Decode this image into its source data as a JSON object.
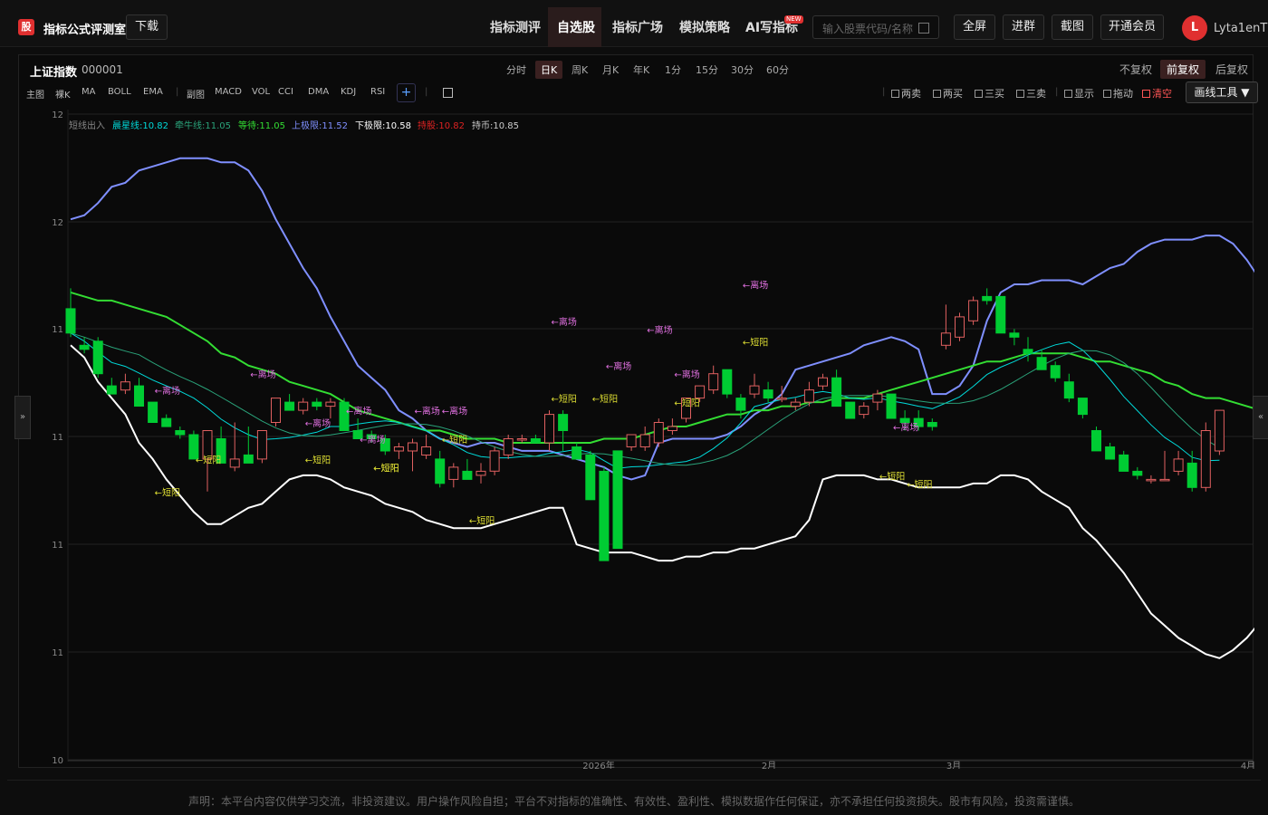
{
  "app": {
    "logo_text": "股",
    "title": "指标公式评测室",
    "download": "下载"
  },
  "nav": {
    "items": [
      "指标测评",
      "自选股",
      "指标广场",
      "模拟策略",
      "AI写指标"
    ],
    "active": 1,
    "new_badge": "NEW"
  },
  "search": {
    "placeholder": "输入股票代码/名称"
  },
  "actions": {
    "fullscreen": "全屏",
    "join": "进群",
    "screenshot": "截图",
    "member": "开通会员"
  },
  "user": {
    "initial": "L",
    "name": "Lyta1enT"
  },
  "stock": {
    "name": "上证指数",
    "code": "000001"
  },
  "periods": {
    "items": [
      "分时",
      "日K",
      "周K",
      "月K",
      "年K",
      "1分",
      "15分",
      "30分",
      "60分"
    ],
    "active": 1
  },
  "adjust": {
    "items": [
      "不复权",
      "前复权",
      "后复权"
    ],
    "active": 1
  },
  "indicators": {
    "main_label": "主图",
    "main": [
      "裸K",
      "MA",
      "BOLL",
      "EMA"
    ],
    "sub_label": "副图",
    "sub": [
      "MACD",
      "VOL",
      "CCI",
      "DMA",
      "KDJ",
      "RSI"
    ],
    "add": "+"
  },
  "signals": {
    "items": [
      "两卖",
      "两买",
      "三买",
      "三卖"
    ],
    "tools": [
      "显示",
      "拖动"
    ],
    "clear": "清空",
    "draw_tool": "画线工具 ▼"
  },
  "legend": {
    "name": "短线出入",
    "entries": [
      {
        "label": "晨星线:10.82",
        "color": "#00d9d9"
      },
      {
        "label": "牵牛线:11.05",
        "color": "#2aa37a"
      },
      {
        "label": "等待:11.05",
        "color": "#33dd33"
      },
      {
        "label": "上极限:11.52",
        "color": "#7f8fff"
      },
      {
        "label": "下极限:10.58",
        "color": "#ffffff"
      },
      {
        "label": "持股:10.82",
        "color": "#dd2222"
      },
      {
        "label": "持币:10.85",
        "color": "#cccccc"
      }
    ]
  },
  "chart_data": {
    "type": "candlestick",
    "y_ticks": [
      "12",
      "12",
      "11",
      "11",
      "11",
      "11",
      "10"
    ],
    "x_ticks": [
      "2026年",
      "2月",
      "3月",
      "4月"
    ],
    "up_color": "#e06060",
    "down_color": "#00cc33",
    "candles": [
      {
        "o": 11.93,
        "h": 11.98,
        "l": 11.86,
        "c": 11.87
      },
      {
        "o": 11.84,
        "h": 11.86,
        "l": 11.82,
        "c": 11.83
      },
      {
        "o": 11.85,
        "h": 11.86,
        "l": 11.76,
        "c": 11.77
      },
      {
        "o": 11.74,
        "h": 11.76,
        "l": 11.72,
        "c": 11.72
      },
      {
        "o": 11.73,
        "h": 11.77,
        "l": 11.72,
        "c": 11.75
      },
      {
        "o": 11.74,
        "h": 11.76,
        "l": 11.69,
        "c": 11.69
      },
      {
        "o": 11.7,
        "h": 11.7,
        "l": 11.65,
        "c": 11.65
      },
      {
        "o": 11.66,
        "h": 11.67,
        "l": 11.64,
        "c": 11.64
      },
      {
        "o": 11.63,
        "h": 11.64,
        "l": 11.61,
        "c": 11.62
      },
      {
        "o": 11.62,
        "h": 11.63,
        "l": 11.56,
        "c": 11.56
      },
      {
        "o": 11.56,
        "h": 11.63,
        "l": 11.48,
        "c": 11.63
      },
      {
        "o": 11.61,
        "h": 11.64,
        "l": 11.55,
        "c": 11.55
      },
      {
        "o": 11.54,
        "h": 11.65,
        "l": 11.53,
        "c": 11.56
      },
      {
        "o": 11.57,
        "h": 11.64,
        "l": 11.56,
        "c": 11.55
      },
      {
        "o": 11.56,
        "h": 11.63,
        "l": 11.55,
        "c": 11.63
      },
      {
        "o": 11.65,
        "h": 11.71,
        "l": 11.64,
        "c": 11.71
      },
      {
        "o": 11.7,
        "h": 11.72,
        "l": 11.68,
        "c": 11.68
      },
      {
        "o": 11.68,
        "h": 11.71,
        "l": 11.67,
        "c": 11.7
      },
      {
        "o": 11.7,
        "h": 11.71,
        "l": 11.68,
        "c": 11.69
      },
      {
        "o": 11.69,
        "h": 11.71,
        "l": 11.66,
        "c": 11.7
      },
      {
        "o": 11.7,
        "h": 11.71,
        "l": 11.63,
        "c": 11.63
      },
      {
        "o": 11.63,
        "h": 11.66,
        "l": 11.61,
        "c": 11.61
      },
      {
        "o": 11.62,
        "h": 11.63,
        "l": 11.6,
        "c": 11.61
      },
      {
        "o": 11.61,
        "h": 11.62,
        "l": 11.57,
        "c": 11.58
      },
      {
        "o": 11.58,
        "h": 11.6,
        "l": 11.56,
        "c": 11.59
      },
      {
        "o": 11.58,
        "h": 11.61,
        "l": 11.53,
        "c": 11.6
      },
      {
        "o": 11.57,
        "h": 11.62,
        "l": 11.56,
        "c": 11.59
      },
      {
        "o": 11.56,
        "h": 11.58,
        "l": 11.49,
        "c": 11.5
      },
      {
        "o": 11.51,
        "h": 11.55,
        "l": 11.49,
        "c": 11.54
      },
      {
        "o": 11.53,
        "h": 11.56,
        "l": 11.52,
        "c": 11.51
      },
      {
        "o": 11.52,
        "h": 11.55,
        "l": 11.5,
        "c": 11.53
      },
      {
        "o": 11.53,
        "h": 11.59,
        "l": 11.52,
        "c": 11.58
      },
      {
        "o": 11.57,
        "h": 11.62,
        "l": 11.56,
        "c": 11.61
      },
      {
        "o": 11.61,
        "h": 11.62,
        "l": 11.6,
        "c": 11.61
      },
      {
        "o": 11.61,
        "h": 11.62,
        "l": 11.6,
        "c": 11.6
      },
      {
        "o": 11.6,
        "h": 11.68,
        "l": 11.58,
        "c": 11.67
      },
      {
        "o": 11.67,
        "h": 11.68,
        "l": 11.58,
        "c": 11.63
      },
      {
        "o": 11.59,
        "h": 11.6,
        "l": 11.56,
        "c": 11.56
      },
      {
        "o": 11.57,
        "h": 11.58,
        "l": 11.46,
        "c": 11.46
      },
      {
        "o": 11.53,
        "h": 11.54,
        "l": 11.31,
        "c": 11.31
      },
      {
        "o": 11.58,
        "h": 11.58,
        "l": 11.35,
        "c": 11.34
      },
      {
        "o": 11.59,
        "h": 11.62,
        "l": 11.58,
        "c": 11.62
      },
      {
        "o": 11.59,
        "h": 11.64,
        "l": 11.58,
        "c": 11.62
      },
      {
        "o": 11.6,
        "h": 11.66,
        "l": 11.59,
        "c": 11.65
      },
      {
        "o": 11.63,
        "h": 11.66,
        "l": 11.62,
        "c": 11.64
      },
      {
        "o": 11.66,
        "h": 11.71,
        "l": 11.65,
        "c": 11.71
      },
      {
        "o": 11.71,
        "h": 11.74,
        "l": 11.7,
        "c": 11.74
      },
      {
        "o": 11.73,
        "h": 11.79,
        "l": 11.72,
        "c": 11.77
      },
      {
        "o": 11.78,
        "h": 11.78,
        "l": 11.71,
        "c": 11.72
      },
      {
        "o": 11.71,
        "h": 11.72,
        "l": 11.66,
        "c": 11.68
      },
      {
        "o": 11.72,
        "h": 11.77,
        "l": 11.71,
        "c": 11.74
      },
      {
        "o": 11.73,
        "h": 11.75,
        "l": 11.7,
        "c": 11.71
      },
      {
        "o": 11.71,
        "h": 11.74,
        "l": 11.7,
        "c": 11.71
      },
      {
        "o": 11.69,
        "h": 11.71,
        "l": 11.68,
        "c": 11.7
      },
      {
        "o": 11.7,
        "h": 11.75,
        "l": 11.69,
        "c": 11.73
      },
      {
        "o": 11.74,
        "h": 11.77,
        "l": 11.73,
        "c": 11.76
      },
      {
        "o": 11.76,
        "h": 11.78,
        "l": 11.69,
        "c": 11.69
      },
      {
        "o": 11.7,
        "h": 11.7,
        "l": 11.66,
        "c": 11.66
      },
      {
        "o": 11.67,
        "h": 11.7,
        "l": 11.66,
        "c": 11.69
      },
      {
        "o": 11.7,
        "h": 11.73,
        "l": 11.68,
        "c": 11.72
      },
      {
        "o": 11.72,
        "h": 11.72,
        "l": 11.66,
        "c": 11.66
      },
      {
        "o": 11.66,
        "h": 11.68,
        "l": 11.63,
        "c": 11.65
      },
      {
        "o": 11.66,
        "h": 11.68,
        "l": 11.63,
        "c": 11.64
      },
      {
        "o": 11.65,
        "h": 11.66,
        "l": 11.63,
        "c": 11.64
      },
      {
        "o": 11.84,
        "h": 11.94,
        "l": 11.83,
        "c": 11.87
      },
      {
        "o": 11.86,
        "h": 11.92,
        "l": 11.85,
        "c": 11.91
      },
      {
        "o": 11.9,
        "h": 11.96,
        "l": 11.89,
        "c": 11.95
      },
      {
        "o": 11.96,
        "h": 11.98,
        "l": 11.94,
        "c": 11.95
      },
      {
        "o": 11.96,
        "h": 11.96,
        "l": 11.87,
        "c": 11.87
      },
      {
        "o": 11.87,
        "h": 11.88,
        "l": 11.84,
        "c": 11.86
      },
      {
        "o": 11.83,
        "h": 11.86,
        "l": 11.8,
        "c": 11.82
      },
      {
        "o": 11.81,
        "h": 11.83,
        "l": 11.78,
        "c": 11.78
      },
      {
        "o": 11.79,
        "h": 11.8,
        "l": 11.75,
        "c": 11.76
      },
      {
        "o": 11.75,
        "h": 11.77,
        "l": 11.7,
        "c": 11.71
      },
      {
        "o": 11.71,
        "h": 11.71,
        "l": 11.66,
        "c": 11.67
      },
      {
        "o": 11.63,
        "h": 11.64,
        "l": 11.58,
        "c": 11.58
      },
      {
        "o": 11.59,
        "h": 11.6,
        "l": 11.56,
        "c": 11.56
      },
      {
        "o": 11.57,
        "h": 11.58,
        "l": 11.53,
        "c": 11.53
      },
      {
        "o": 11.53,
        "h": 11.54,
        "l": 11.51,
        "c": 11.52
      },
      {
        "o": 11.51,
        "h": 11.52,
        "l": 11.5,
        "c": 11.51
      },
      {
        "o": 11.51,
        "h": 11.58,
        "l": 11.51,
        "c": 11.51
      },
      {
        "o": 11.53,
        "h": 11.58,
        "l": 11.52,
        "c": 11.56
      },
      {
        "o": 11.55,
        "h": 11.58,
        "l": 11.48,
        "c": 11.49
      },
      {
        "o": 11.49,
        "h": 11.65,
        "l": 11.48,
        "c": 11.63
      },
      {
        "o": 11.58,
        "h": 11.68,
        "l": 11.57,
        "c": 11.68
      }
    ],
    "signals": [
      {
        "i": 6,
        "text": "←离场",
        "type": "exit",
        "price": 11.72
      },
      {
        "i": 6,
        "text": "←短阳",
        "type": "entry",
        "price": 11.47
      },
      {
        "i": 9,
        "text": "←短阳",
        "type": "entry",
        "price": 11.55
      },
      {
        "i": 13,
        "text": "←离场",
        "type": "exit",
        "price": 11.76
      },
      {
        "i": 17,
        "text": "←离场",
        "type": "exit",
        "price": 11.64
      },
      {
        "i": 17,
        "text": "←短阳",
        "type": "entry",
        "price": 11.55
      },
      {
        "i": 21,
        "text": "←离场",
        "type": "exit",
        "price": 11.6
      },
      {
        "i": 20,
        "text": "←离场",
        "type": "exit",
        "price": 11.67
      },
      {
        "i": 22,
        "text": "←短阳",
        "type": "entry",
        "price": 11.53
      },
      {
        "i": 22,
        "text": "←短阳",
        "type": "entry",
        "price": 11.53
      },
      {
        "i": 25,
        "text": "←离场",
        "type": "exit",
        "price": 11.67
      },
      {
        "i": 27,
        "text": "←短阳",
        "type": "entry",
        "price": 11.6
      },
      {
        "i": 27,
        "text": "←离场",
        "type": "exit",
        "price": 11.67
      },
      {
        "i": 29,
        "text": "←短阳",
        "type": "entry",
        "price": 11.4
      },
      {
        "i": 35,
        "text": "←离场",
        "type": "exit",
        "price": 11.89
      },
      {
        "i": 35,
        "text": "←短阳",
        "type": "entry",
        "price": 11.7
      },
      {
        "i": 39,
        "text": "←离场",
        "type": "exit",
        "price": 11.78
      },
      {
        "i": 38,
        "text": "←短阳",
        "type": "entry",
        "price": 11.7
      },
      {
        "i": 42,
        "text": "←离场",
        "type": "exit",
        "price": 11.87
      },
      {
        "i": 44,
        "text": "←离场",
        "type": "exit",
        "price": 11.76
      },
      {
        "i": 44,
        "text": "←短阳",
        "type": "entry",
        "price": 11.69
      },
      {
        "i": 49,
        "text": "←短阳",
        "type": "entry",
        "price": 11.84
      },
      {
        "i": 49,
        "text": "←离场",
        "type": "exit",
        "price": 11.98
      },
      {
        "i": 59,
        "text": "←短阳",
        "type": "entry",
        "price": 11.51
      },
      {
        "i": 60,
        "text": "←离场",
        "type": "exit",
        "price": 11.63
      },
      {
        "i": 61,
        "text": "←短阳",
        "type": "entry",
        "price": 11.49
      }
    ],
    "lines": {
      "upper": [
        12.15,
        12.16,
        12.19,
        12.23,
        12.24,
        12.27,
        12.28,
        12.29,
        12.3,
        12.3,
        12.3,
        12.29,
        12.29,
        12.27,
        12.22,
        12.15,
        12.09,
        12.03,
        11.98,
        11.91,
        11.85,
        11.79,
        11.76,
        11.73,
        11.68,
        11.66,
        11.63,
        11.61,
        11.6,
        11.59,
        11.6,
        11.6,
        11.59,
        11.58,
        11.58,
        11.58,
        11.57,
        11.56,
        11.55,
        11.54,
        11.52,
        11.51,
        11.52,
        11.6,
        11.61,
        11.61,
        11.61,
        11.61,
        11.62,
        11.64,
        11.67,
        11.69,
        11.72,
        11.78,
        11.79,
        11.8,
        11.81,
        11.82,
        11.84,
        11.85,
        11.86,
        11.85,
        11.83,
        11.72,
        11.72,
        11.74,
        11.79,
        11.9,
        11.97,
        11.99,
        11.99,
        12.0,
        12.0,
        12.0,
        11.99,
        12.01,
        12.03,
        12.04,
        12.07,
        12.09,
        12.1,
        12.1,
        12.1,
        12.11,
        12.11,
        12.09,
        12.05,
        12.0
      ],
      "lower": [
        11.84,
        11.81,
        11.75,
        11.71,
        11.67,
        11.6,
        11.56,
        11.51,
        11.47,
        11.43,
        11.4,
        11.4,
        11.42,
        11.44,
        11.45,
        11.48,
        11.51,
        11.52,
        11.52,
        11.51,
        11.49,
        11.48,
        11.47,
        11.45,
        11.44,
        11.43,
        11.41,
        11.4,
        11.39,
        11.39,
        11.39,
        11.4,
        11.41,
        11.42,
        11.43,
        11.44,
        11.44,
        11.35,
        11.34,
        11.33,
        11.33,
        11.33,
        11.32,
        11.31,
        11.31,
        11.32,
        11.32,
        11.33,
        11.33,
        11.34,
        11.34,
        11.35,
        11.36,
        11.37,
        11.41,
        11.51,
        11.52,
        11.52,
        11.52,
        11.51,
        11.51,
        11.5,
        11.49,
        11.49,
        11.49,
        11.49,
        11.5,
        11.5,
        11.52,
        11.52,
        11.51,
        11.48,
        11.46,
        11.44,
        11.39,
        11.36,
        11.32,
        11.28,
        11.23,
        11.18,
        11.15,
        11.12,
        11.1,
        11.08,
        11.07,
        11.09,
        11.12,
        11.16
      ],
      "wait": [
        11.97,
        11.96,
        11.95,
        11.95,
        11.94,
        11.93,
        11.92,
        11.91,
        11.89,
        11.87,
        11.85,
        11.82,
        11.81,
        11.79,
        11.78,
        11.77,
        11.75,
        11.74,
        11.73,
        11.72,
        11.7,
        11.68,
        11.67,
        11.66,
        11.65,
        11.64,
        11.63,
        11.63,
        11.62,
        11.61,
        11.61,
        11.61,
        11.6,
        11.6,
        11.6,
        11.6,
        11.6,
        11.6,
        11.6,
        11.61,
        11.61,
        11.61,
        11.62,
        11.63,
        11.64,
        11.64,
        11.65,
        11.66,
        11.67,
        11.67,
        11.68,
        11.68,
        11.69,
        11.69,
        11.7,
        11.7,
        11.71,
        11.71,
        11.71,
        11.72,
        11.73,
        11.74,
        11.75,
        11.76,
        11.77,
        11.78,
        11.79,
        11.8,
        11.8,
        11.81,
        11.82,
        11.82,
        11.82,
        11.82,
        11.81,
        11.8,
        11.8,
        11.79,
        11.78,
        11.77,
        11.75,
        11.74,
        11.72,
        11.71,
        11.71,
        11.7,
        11.69,
        11.68
      ]
    }
  },
  "sidetabs": {
    "left": "»",
    "right": "«"
  },
  "footer": {
    "disclaimer": "声明：本平台内容仅供学习交流，非投资建议。用户操作风险自担；平台不对指标的准确性、有效性、盈利性、模拟数据作任何保证，亦不承担任何投资损失。股市有风险，投资需谨慎。"
  }
}
